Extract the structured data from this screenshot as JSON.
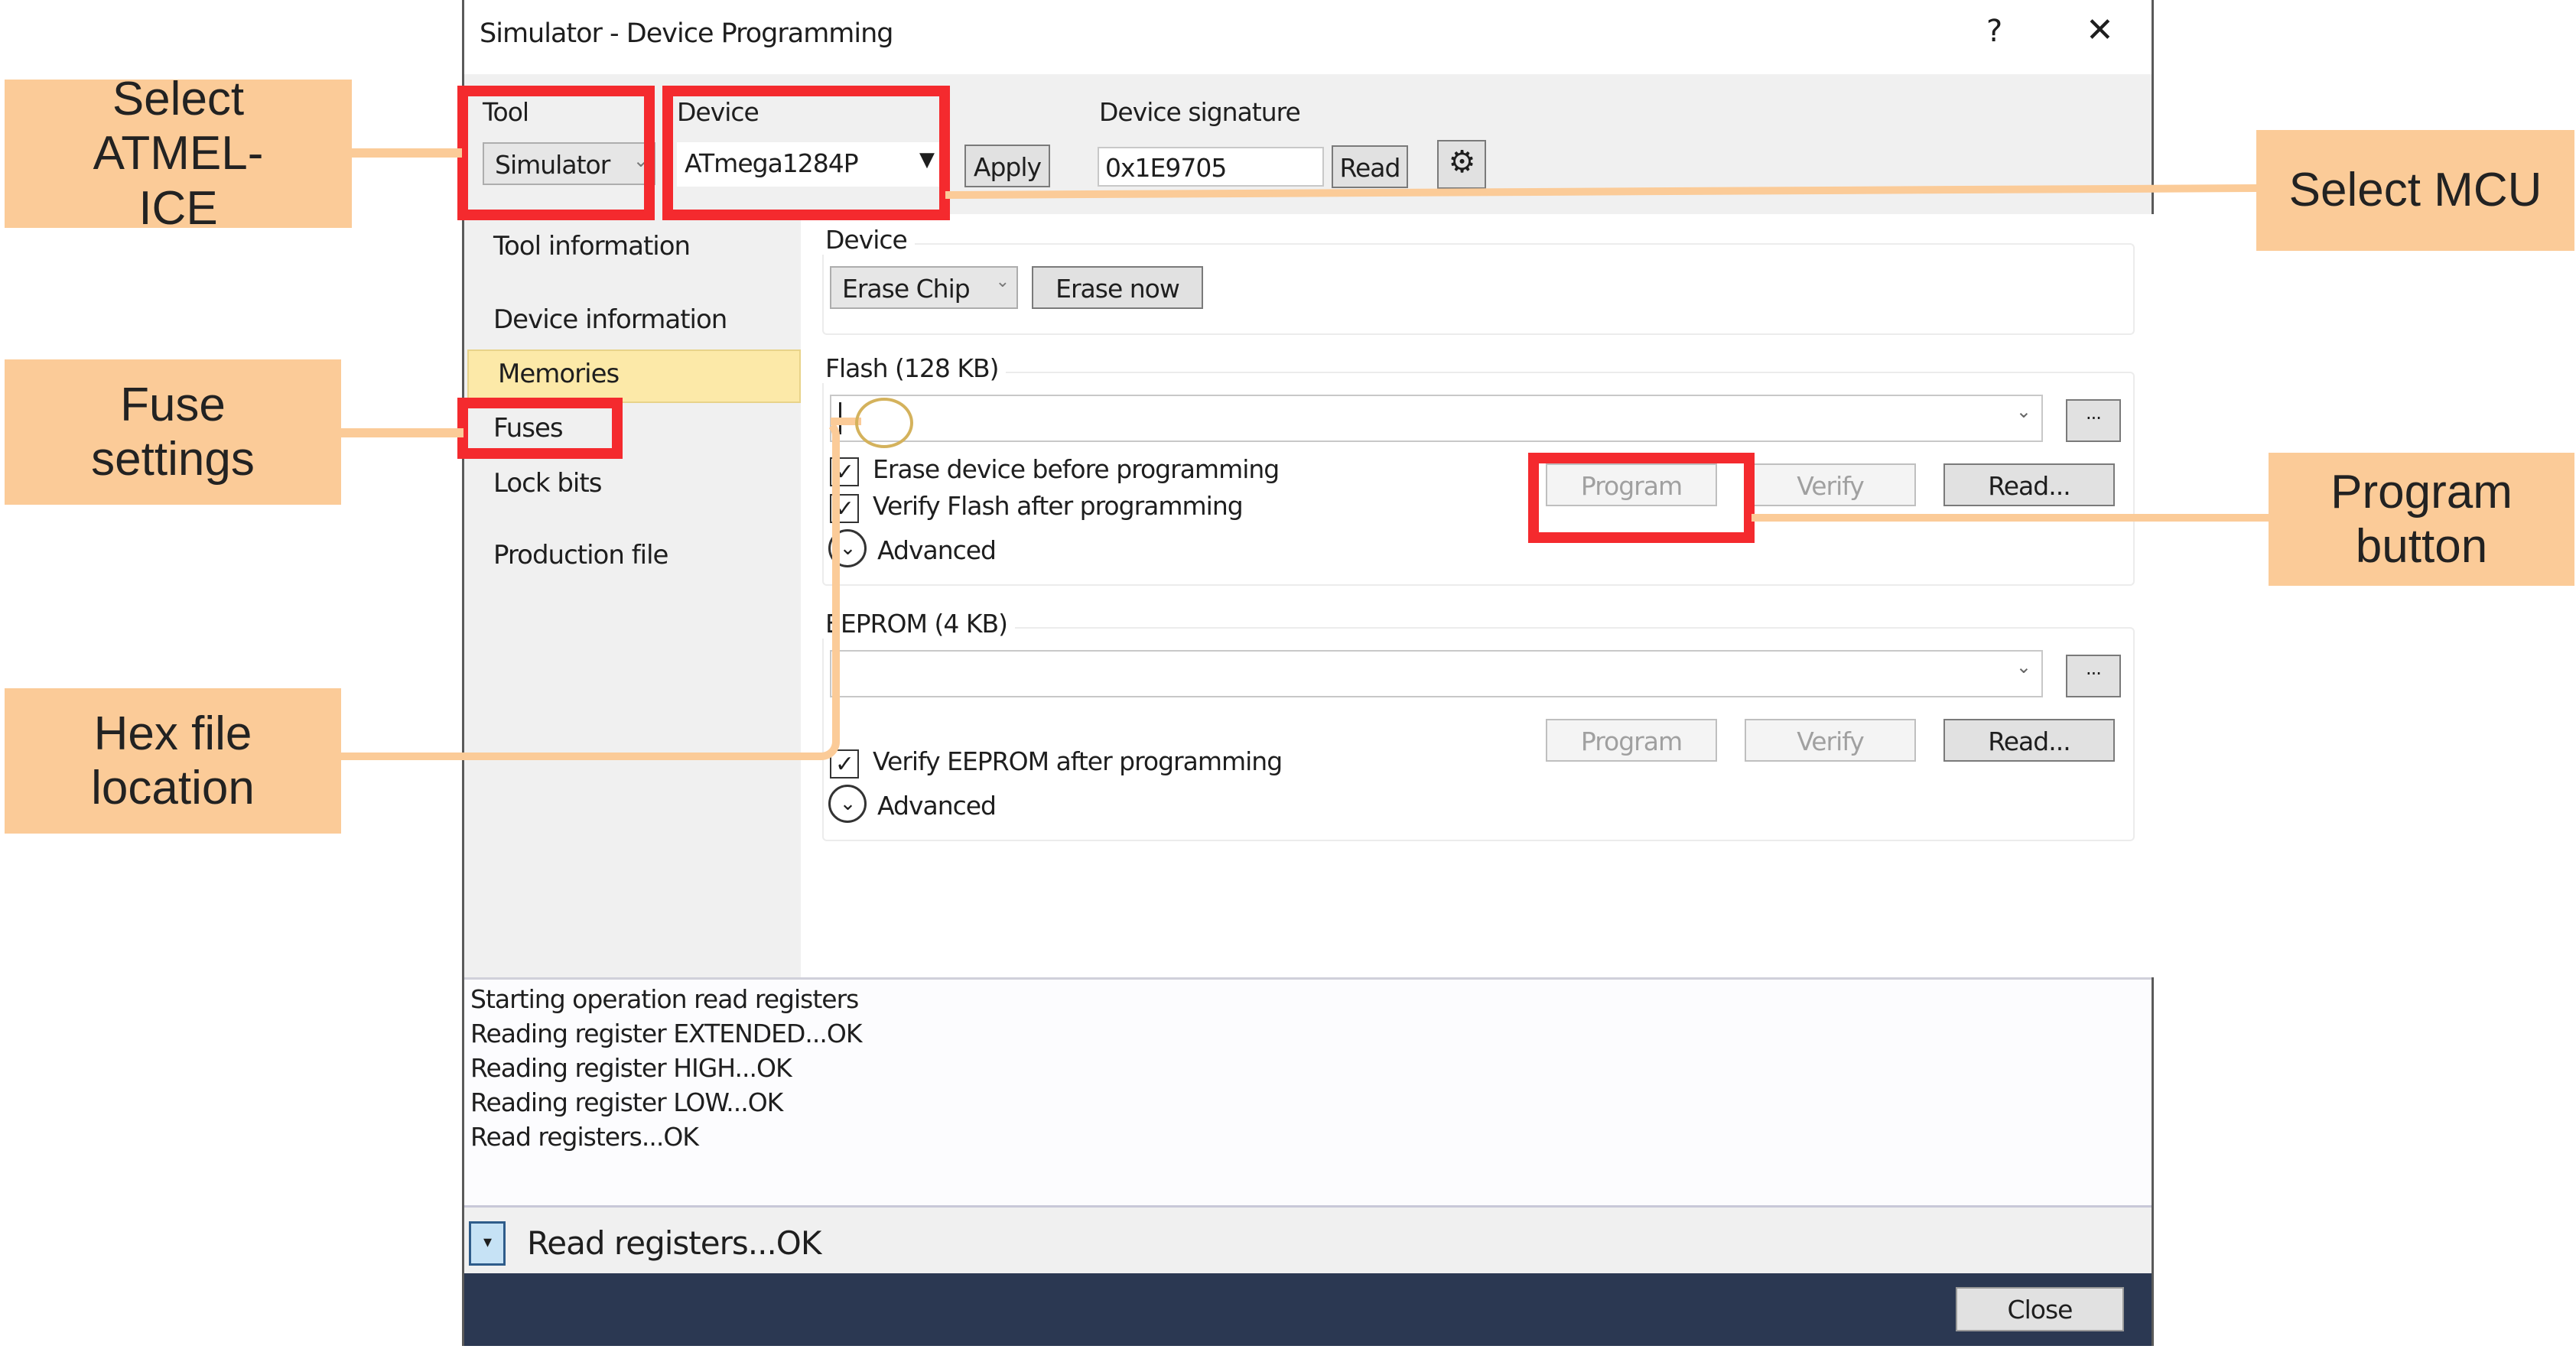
{
  "window": {
    "title": "Simulator - Device Programming",
    "help_label": "?",
    "close_label": "✕"
  },
  "header": {
    "tool_label": "Tool",
    "tool_value": "Simulator",
    "device_label": "Device",
    "device_value": "ATmega1284P",
    "apply_label": "Apply",
    "signature_label": "Device signature",
    "signature_value": "0x1E9705",
    "read_label": "Read",
    "settings_icon": "gear-icon"
  },
  "sidebar": {
    "items": [
      {
        "label": "Tool information",
        "selected": false
      },
      {
        "label": "Device information",
        "selected": false
      },
      {
        "label": "Memories",
        "selected": true
      },
      {
        "label": "Fuses",
        "selected": false
      },
      {
        "label": "Lock bits",
        "selected": false
      },
      {
        "label": "Production file",
        "selected": false
      }
    ]
  },
  "device_group": {
    "title": "Device",
    "erase_mode": "Erase Chip",
    "erase_now_label": "Erase now"
  },
  "flash_group": {
    "title": "Flash (128 KB)",
    "file_value": "",
    "browse_label": "...",
    "erase_before_label": "Erase device before programming",
    "erase_before_checked": true,
    "verify_after_label": "Verify Flash after programming",
    "verify_after_checked": true,
    "advanced_label": "Advanced",
    "program_label": "Program",
    "verify_label": "Verify",
    "read_label": "Read..."
  },
  "eeprom_group": {
    "title": "EEPROM (4 KB)",
    "file_value": "",
    "browse_label": "...",
    "verify_after_label": "Verify EEPROM after programming",
    "verify_after_checked": true,
    "advanced_label": "Advanced",
    "program_label": "Program",
    "verify_label": "Verify",
    "read_label": "Read..."
  },
  "log": {
    "lines": [
      "Starting operation read registers",
      "Reading register EXTENDED...OK",
      "Reading register HIGH...OK",
      "Reading register LOW...OK",
      "Read registers...OK"
    ]
  },
  "status": {
    "text": "Read registers...OK",
    "expand_icon": "▾"
  },
  "footer": {
    "close_label": "Close"
  },
  "annotations": {
    "select_tool": "Select ATMEL-ICE",
    "fuse_settings": "Fuse settings",
    "hex_file": "Hex file location",
    "select_mcu": "Select MCU",
    "program_button": "Program button"
  },
  "colors": {
    "callout": "#fbcb98",
    "highlight_box": "#f42a2e",
    "selected_nav": "#fce9a8",
    "footer": "#2b3852"
  }
}
